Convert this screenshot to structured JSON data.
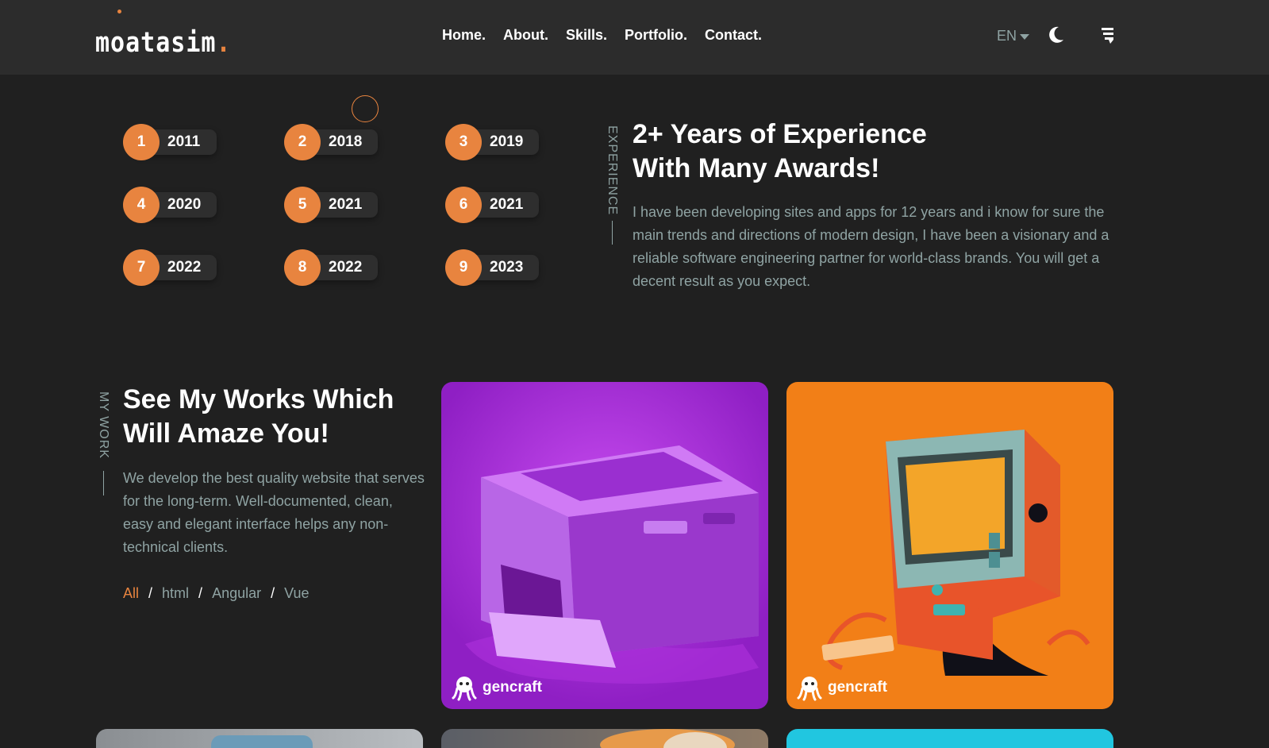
{
  "header": {
    "logo_text": "moatasim",
    "logo_dot": ".",
    "nav": [
      "Home.",
      "About.",
      "Skills.",
      "Portfolio.",
      "Contact."
    ],
    "language": "EN"
  },
  "experience": {
    "side_label": "EXPERIENCE",
    "title_line1": "2+ Years of Experience",
    "title_line2": "With Many Awards!",
    "text": "I have been developing sites and apps for 12 years and i know for sure the main trends and directions of modern design, I have been a visionary and a reliable software engineering partner for world-class brands. You will get a decent result as you expect.",
    "years": [
      {
        "num": "1",
        "year": "2011"
      },
      {
        "num": "2",
        "year": "2018"
      },
      {
        "num": "3",
        "year": "2019"
      },
      {
        "num": "4",
        "year": "2020"
      },
      {
        "num": "5",
        "year": "2021"
      },
      {
        "num": "6",
        "year": "2021"
      },
      {
        "num": "7",
        "year": "2022"
      },
      {
        "num": "8",
        "year": "2022"
      },
      {
        "num": "9",
        "year": "2023"
      }
    ]
  },
  "works": {
    "side_label": "MY WORK",
    "title_line1": "See My Works Which",
    "title_line2": "Will Amaze You!",
    "text": "We develop the best quality website that serves for the long-term. Well-documented, clean, easy and elegant interface helps any non-technical clients.",
    "filters": [
      "All",
      "html",
      "Angular",
      "Vue"
    ],
    "filter_separator": "/",
    "cards": [
      {
        "brand": "gencraft",
        "subject": "printer"
      },
      {
        "brand": "gencraft",
        "subject": "retro-computer"
      }
    ]
  },
  "colors": {
    "accent": "#e8843f",
    "background": "#202020",
    "header": "#2c2c2c",
    "muted_text": "#8fa3a3"
  }
}
